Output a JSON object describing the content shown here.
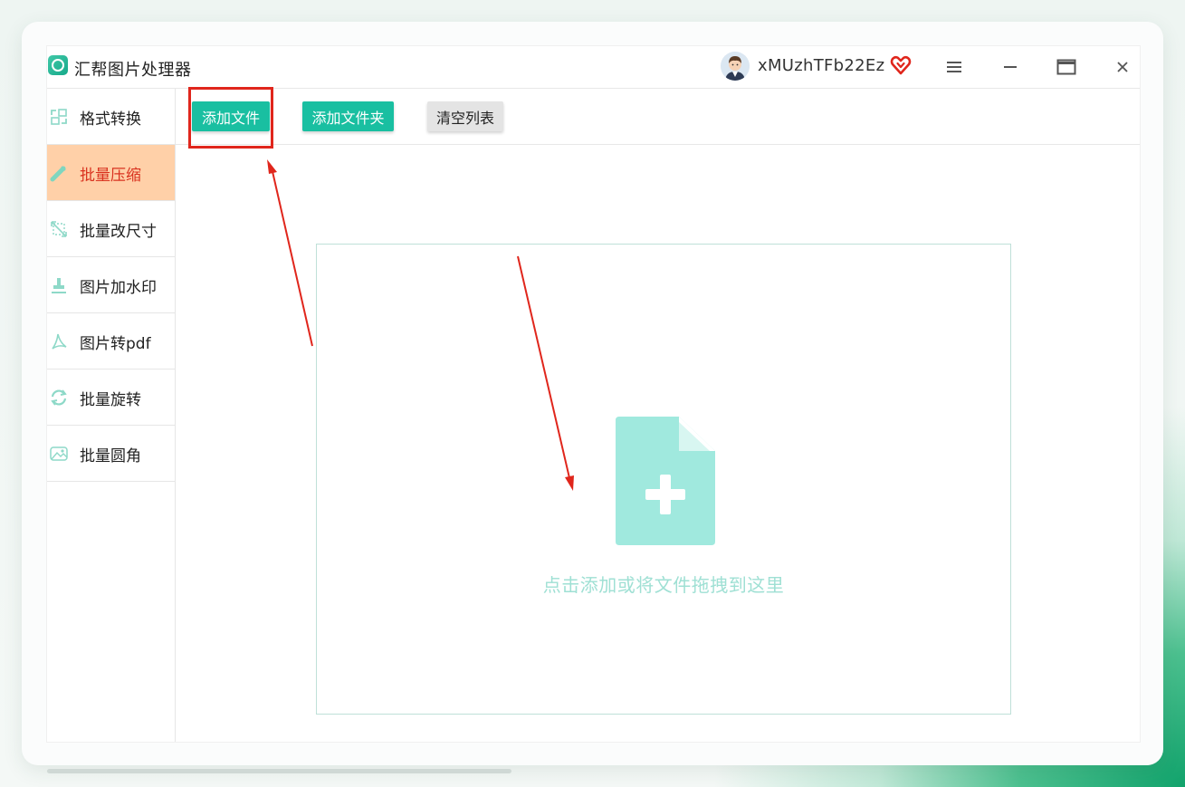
{
  "app": {
    "title": "汇帮图片处理器",
    "username": "xMUzhTFb22Ez"
  },
  "sidebar": {
    "items": [
      {
        "label": "格式转换",
        "icon": "format-convert-icon",
        "active": false
      },
      {
        "label": "批量压缩",
        "icon": "compress-icon",
        "active": true
      },
      {
        "label": "批量改尺寸",
        "icon": "resize-icon",
        "active": false
      },
      {
        "label": "图片加水印",
        "icon": "watermark-icon",
        "active": false
      },
      {
        "label": "图片转pdf",
        "icon": "pdf-icon",
        "active": false
      },
      {
        "label": "批量旋转",
        "icon": "rotate-icon",
        "active": false
      },
      {
        "label": "批量圆角",
        "icon": "rounded-corner-icon",
        "active": false
      }
    ]
  },
  "toolbar": {
    "add_file": "添加文件",
    "add_folder": "添加文件夹",
    "clear_list": "清空列表"
  },
  "dropzone": {
    "text": "点击添加或将文件拖拽到这里"
  },
  "colors": {
    "accent": "#19bfa1",
    "active_bg": "#ffd0a8",
    "active_text": "#d9321f",
    "annotation_red": "#e0261c",
    "drop_text": "#9fe0d4"
  }
}
